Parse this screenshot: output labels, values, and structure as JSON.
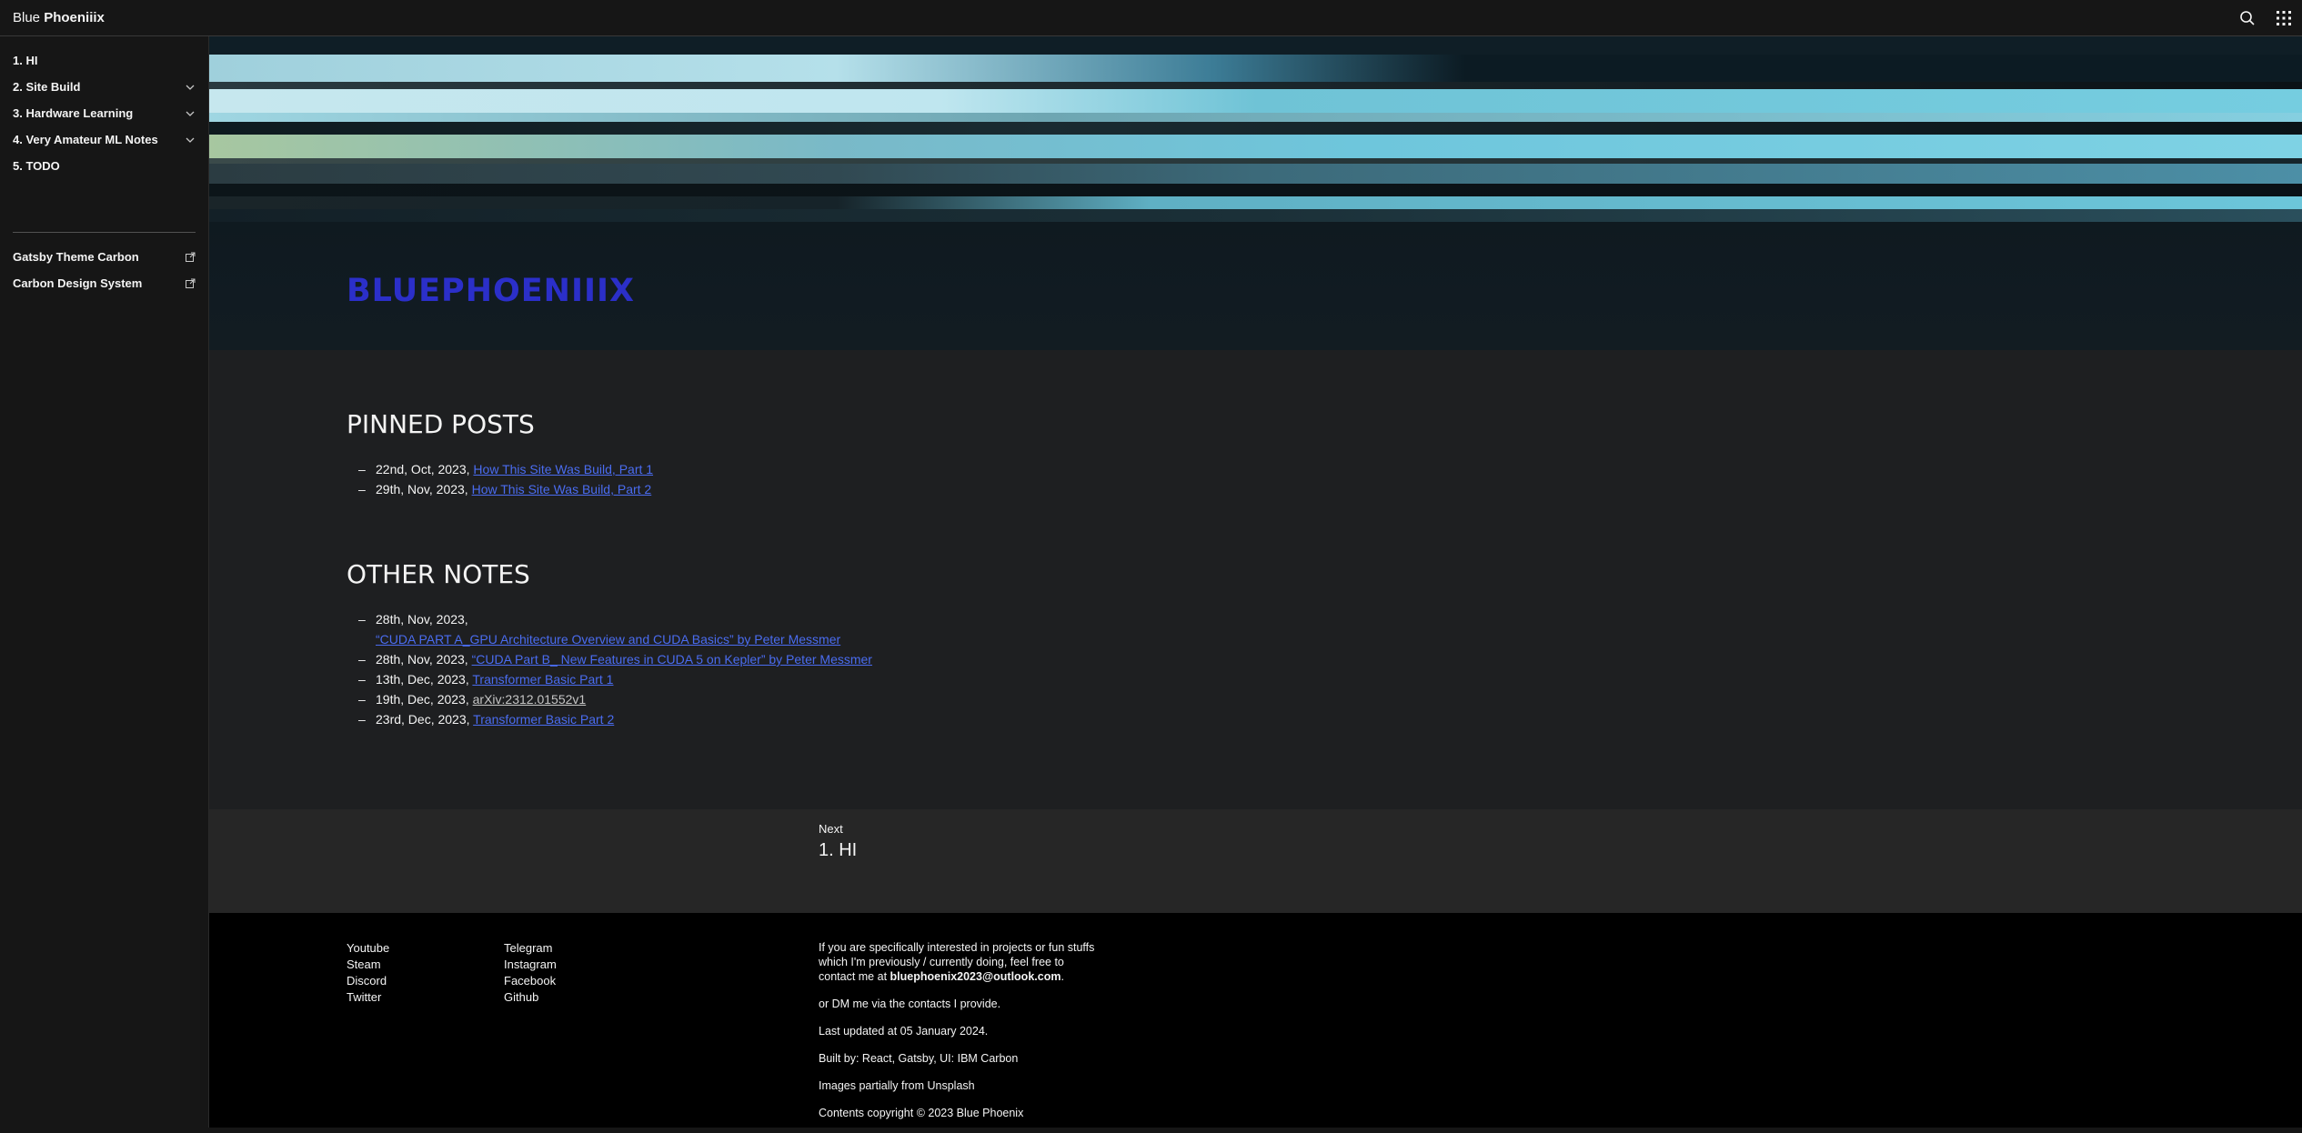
{
  "header": {
    "brand_light": "Blue",
    "brand_bold": "Phoeniiix",
    "search_icon": "search-icon",
    "switcher_icon": "app-switcher-icon"
  },
  "sidebar": {
    "items": [
      {
        "label": "1. HI",
        "expandable": false
      },
      {
        "label": "2. Site Build",
        "expandable": true
      },
      {
        "label": "3. Hardware Learning",
        "expandable": true
      },
      {
        "label": "4. Very Amateur ML Notes",
        "expandable": true
      },
      {
        "label": "5. TODO",
        "expandable": false
      }
    ],
    "external_links": [
      {
        "label": "Gatsby Theme Carbon",
        "icon": "launch-icon"
      },
      {
        "label": "Carbon Design System",
        "icon": "launch-icon"
      }
    ]
  },
  "hero": {
    "title": "BLUEPHOENIIIX"
  },
  "pinned": {
    "title": "PINNED POSTS",
    "posts": [
      {
        "date": "22nd, Oct, 2023,",
        "link": "How This Site Was Build, Part 1"
      },
      {
        "date": "29th, Nov, 2023,",
        "link": "How This Site Was Build, Part 2"
      }
    ]
  },
  "other": {
    "title": "OTHER NOTES",
    "posts": [
      {
        "date": "28th, Nov, 2023,",
        "link": "“CUDA PART A_GPU Architecture Overview and CUDA Basics” by Peter Messmer",
        "wrap": true
      },
      {
        "date": "28th, Nov, 2023,",
        "link": "“CUDA Part B_ New Features in CUDA 5 on Kepler” by Peter Messmer"
      },
      {
        "date": "13th, Dec, 2023,",
        "link": "Transformer Basic Part 1"
      },
      {
        "date": "19th, Dec, 2023,",
        "link": "arXiv:2312.01552v1",
        "plain_link": true
      },
      {
        "date": "23rd, Dec, 2023,",
        "link": "Transformer Basic Part 2"
      }
    ]
  },
  "next": {
    "label": "Next",
    "title": "1. HI"
  },
  "footer": {
    "col1": [
      "Youtube",
      "Steam",
      "Discord",
      "Twitter"
    ],
    "col2": [
      "Telegram",
      "Instagram",
      "Facebook",
      "Github"
    ],
    "contact_text": "If you are specifically interested in projects or fun stuffs which I'm previously / currently doing, feel free to contact me at",
    "email": "bluephoenix2023@outlook.com",
    "dm_text": "or DM me via the contacts I provide.",
    "updated": "Last updated at 05 January 2024.",
    "built_by": "Built by: React, Gatsby, UI: IBM Carbon",
    "images": "Images partially from Unsplash",
    "copyright": "Contents copyright © 2023 Blue Phoenix"
  },
  "colors": {
    "accent": "#2b2fc9",
    "link": "#4a6cf0",
    "background": "#1e1f21"
  }
}
